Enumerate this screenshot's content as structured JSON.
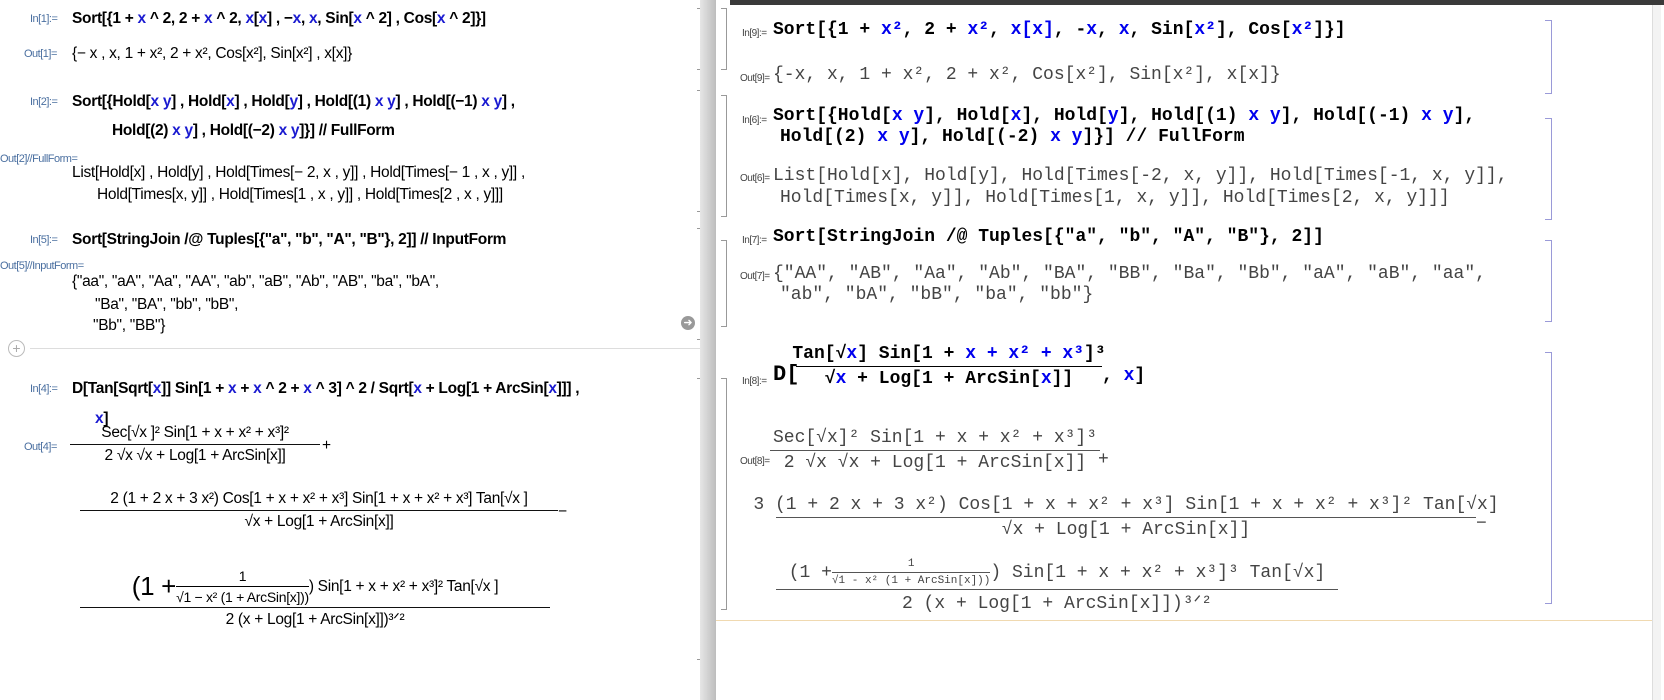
{
  "left": {
    "in1": {
      "label": "In[1]:=",
      "code": [
        "Sort[{1 + ",
        "x",
        " ^ 2, 2 + ",
        "x",
        " ^ 2, ",
        "x",
        "[",
        "x",
        "] , −",
        "x",
        ", ",
        "x",
        ", Sin[",
        "x",
        " ^ 2] , Cos[",
        "x",
        " ^ 2]}]"
      ]
    },
    "out1": {
      "label": "Out[1]=",
      "value": "{− x , x, 1 + x², 2 + x², Cos[x²], Sin[x²] , x[x]}"
    },
    "in2": {
      "label": "In[2]:=",
      "line1": [
        "Sort[{Hold[",
        "x y",
        "] , Hold[",
        "x",
        "] , Hold[",
        "y",
        "] , Hold[(1) ",
        "x y",
        "] , Hold[(−1) ",
        "x y",
        "] ,"
      ],
      "line2": [
        "Hold[(2) ",
        "x y",
        "] , Hold[(−2) ",
        "x y",
        "]}] // FullForm"
      ]
    },
    "out2": {
      "label": "Out[2]//FullForm=",
      "line1": "List[Hold[x] , Hold[y] , Hold[Times[− 2, x , y]] , Hold[Times[− 1 , x , y]] ,",
      "line2": "Hold[Times[x, y]] , Hold[Times[1 , x , y]] , Hold[Times[2 , x , y]]]"
    },
    "in5": {
      "label": "In[5]:=",
      "code": "Sort[StringJoin /@ Tuples[{\"a\", \"b\", \"A\", \"B\"}, 2]] // InputForm"
    },
    "out5": {
      "label": "Out[5]//InputForm=",
      "line1": "{\"aa\",  \"aA\",  \"Aa\",  \"AA\",  \"ab\",  \"aB\",  \"Ab\",  \"AB\",  \"ba\",  \"bA\",",
      "line2": "\"Ba\",  \"BA\",  \"bb\",  \"bB\",",
      "line3": "\"Bb\",  \"BB\"}"
    },
    "in4": {
      "label": "In[4]:=",
      "line1": [
        "D[Tan[Sqrt[",
        "x",
        "]] Sin[1 + ",
        "x",
        " + ",
        "x",
        " ^ 2 + ",
        "x",
        " ^ 3] ^ 2 / Sqrt[",
        "x",
        " + Log[1 + ArcSin[",
        "x",
        "]]] ,"
      ],
      "line2": [
        "",
        "x",
        "]"
      ]
    },
    "out4": {
      "label": "Out[4]=",
      "t1": {
        "num": "Sec[√x ]² Sin[1 + x + x² + x³]²",
        "den": "2 √x  √x + Log[1 + ArcSin[x]]",
        "op": "+"
      },
      "t2": {
        "num": "2 (1 + 2 x + 3 x²) Cos[1 + x + x² + x³] Sin[1 + x + x² + x³] Tan[√x ]",
        "den": "√x + Log[1 + ArcSin[x]]",
        "op": "−"
      },
      "t3": {
        "pre": "(1 + ",
        "inum": "1",
        "iden": "√1 − x²  (1 + ArcSin[x]))",
        "post": ") Sin[1 + x + x² + x³]² Tan[√x ]",
        "den": "2 (x + Log[1 + ArcSin[x]])³ᐟ²"
      }
    }
  },
  "right": {
    "in9": {
      "label": "In[9]:=",
      "code": [
        "Sort[{1 + ",
        "x²",
        ", 2 + ",
        "x²",
        ", ",
        "x[x]",
        ", -",
        "x",
        ", ",
        "x",
        ", Sin[",
        "x²",
        "], Cos[",
        "x²",
        "]}]"
      ]
    },
    "out9": {
      "label": "Out[9]=",
      "value": "{-x, x, 1 + x², 2 + x², Cos[x²], Sin[x²], x[x]}"
    },
    "in6": {
      "label": "In[6]:=",
      "line1": [
        "Sort[{Hold[",
        "x y",
        "], Hold[",
        "x",
        "], Hold[",
        "y",
        "], Hold[(1) ",
        "x y",
        "], Hold[(-1) ",
        "x y",
        "],"
      ],
      "line2": [
        "Hold[(2) ",
        "x y",
        "], Hold[(-2) ",
        "x y",
        "]}] // FullForm"
      ]
    },
    "out6": {
      "label": "Out[6]=",
      "line1": "List[Hold[x], Hold[y], Hold[Times[-2, x, y]], Hold[Times[-1, x, y]],",
      "line2": "Hold[Times[x, y]], Hold[Times[1, x, y]], Hold[Times[2, x, y]]]"
    },
    "in7": {
      "label": "In[7]:=",
      "code": "Sort[StringJoin /@ Tuples[{\"a\", \"b\", \"A\", \"B\"}, 2]]"
    },
    "out7": {
      "label": "Out[7]=",
      "line1": "{\"AA\", \"AB\", \"Aa\", \"Ab\", \"BA\", \"BB\", \"Ba\", \"Bb\", \"aA\", \"aB\", \"aa\",",
      "line2": "\"ab\", \"bA\", \"bB\", \"ba\", \"bb\"}"
    },
    "in8": {
      "label": "In[8]:=",
      "head": "D[",
      "num": [
        "Tan[√",
        "x",
        "] Sin[1 + ",
        "x + x² + x³",
        "]³"
      ],
      "den": [
        "√",
        "x",
        " + Log[1 + ArcSin[",
        "x",
        "]]"
      ],
      "tail": [
        ", ",
        "x",
        "]"
      ]
    },
    "out8": {
      "label": "Out[8]=",
      "t1": {
        "num": "Sec[√x]² Sin[1 + x + x² + x³]³",
        "den": "2 √x √x + Log[1 + ArcSin[x]]",
        "op": "+"
      },
      "t2": {
        "num": "3 (1 + 2 x + 3 x²) Cos[1 + x + x² + x³] Sin[1 + x + x² + x³]² Tan[√x]",
        "den": "√x + Log[1 + ArcSin[x]]",
        "op": "−"
      },
      "t3": {
        "pre": "(1 + ",
        "inum": "1",
        "iden": "√1 - x² (1 + ArcSin[x]))",
        "post": ") Sin[1 + x + x² + x³]³ Tan[√x]",
        "den": "2 (x + Log[1 + ArcSin[x]])³ᐟ²"
      }
    }
  },
  "icons": {
    "add_cell": "plus-icon",
    "run": "arrow-right-icon"
  }
}
